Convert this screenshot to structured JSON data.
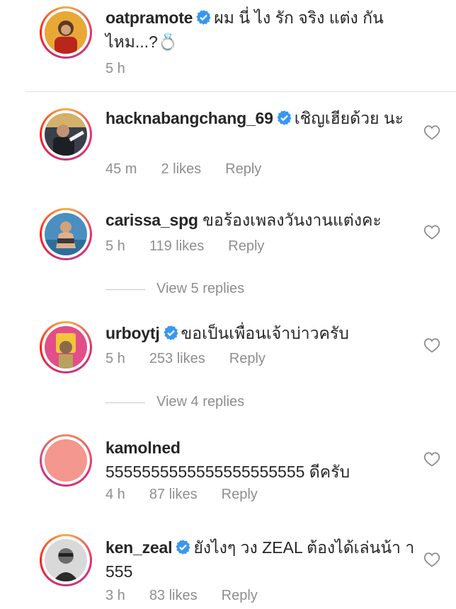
{
  "caption": {
    "username": "oatpramote",
    "text": "ผม นี่ ไง รัก จริง แต่ง กัน ไหม...?💍",
    "time": "5 h"
  },
  "comments": [
    {
      "username": "hacknabangchang_69",
      "verified": true,
      "text": "เชิญเฮียด้วย นะ",
      "time": "45 m",
      "likes": "2 likes",
      "reply": "Reply"
    },
    {
      "username": "carissa_spg",
      "verified": false,
      "text": "ขอร้องเพลงวันงานแต่งคะ",
      "time": "5 h",
      "likes": "119 likes",
      "reply": "Reply",
      "view_replies": "View 5 replies"
    },
    {
      "username": "urboytj",
      "verified": true,
      "text": "ขอเป็นเพื่อนเจ้าบ่าวครับ",
      "time": "5 h",
      "likes": "253 likes",
      "reply": "Reply",
      "view_replies": "View 4 replies"
    },
    {
      "username": "kamolned",
      "verified": false,
      "text": "5555555555555555555555 ดีครับ",
      "time": "4 h",
      "likes": "87 likes",
      "reply": "Reply"
    },
    {
      "username": "ken_zeal",
      "verified": true,
      "text": "ยังไงๆ วง ZEAL ต้องได้เล่นน้า า 555",
      "time": "3 h",
      "likes": "83 likes",
      "reply": "Reply"
    }
  ],
  "colors": {
    "text": "#262626",
    "meta": "#8e8e8e",
    "verified": "#3897f0",
    "kamolned_avatar": "#f4978e"
  },
  "icons": {
    "verified": "verified-badge-icon",
    "like": "heart-outline-icon"
  }
}
